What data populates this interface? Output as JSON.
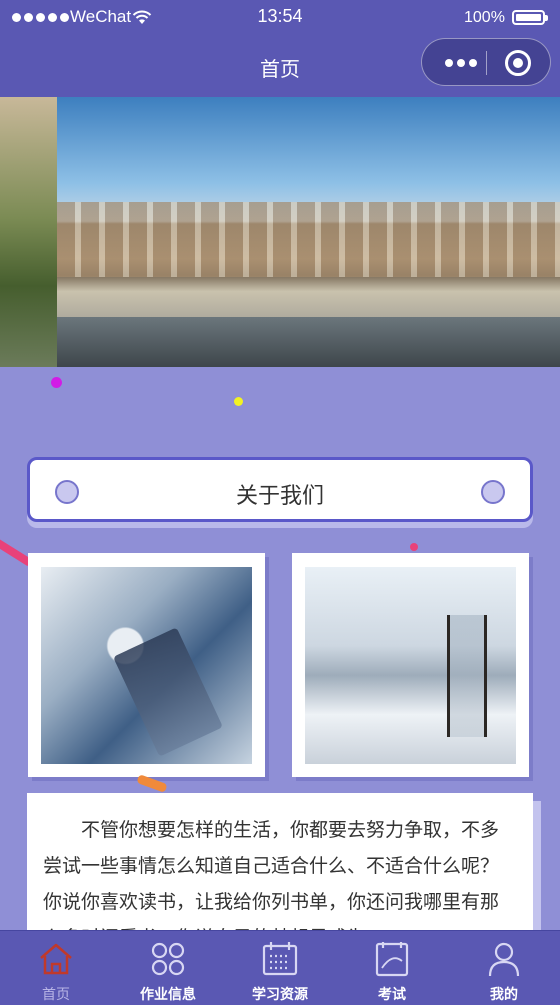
{
  "status_bar": {
    "carrier": "WeChat",
    "time": "13:54",
    "battery": "100%"
  },
  "nav": {
    "title": "首页"
  },
  "about": {
    "title": "关于我们"
  },
  "intro_text": "不管你想要怎样的生活，你都要去努力争取，不多尝试一些事情怎么知道自己适合什么、不适合什么呢？你说你喜欢读书，让我给你列书单，你还问我哪里有那么多时间看书，你说自己的梦想是成为",
  "tabs": [
    {
      "label": "首页",
      "icon": "home-icon",
      "active": true
    },
    {
      "label": "作业信息",
      "icon": "apps-icon",
      "active": false
    },
    {
      "label": "学习资源",
      "icon": "calendar-icon",
      "active": false
    },
    {
      "label": "考试",
      "icon": "exam-icon",
      "active": false
    },
    {
      "label": "我的",
      "icon": "user-icon",
      "active": false
    }
  ],
  "colors": {
    "primary": "#5a58b3",
    "background": "#8f8fd6",
    "active_tab": "#b8b5e6",
    "home_icon": "#c0392b"
  }
}
